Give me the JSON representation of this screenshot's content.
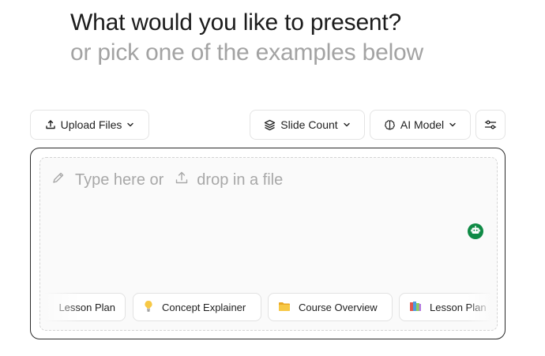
{
  "heading": {
    "title": "What would you like to present?",
    "subtitle": "or pick one of the examples below"
  },
  "toolbar": {
    "upload_label": "Upload Files",
    "slide_count_label": "Slide Count",
    "ai_model_label": "AI Model"
  },
  "input": {
    "prompt_left": "Type here or",
    "prompt_right": "drop in a file"
  },
  "examples": [
    {
      "label": "Lesson Plan",
      "icon": "notebook-icon"
    },
    {
      "label": "Concept Explainer",
      "icon": "lightbulb-icon"
    },
    {
      "label": "Course Overview",
      "icon": "folder-icon"
    },
    {
      "label": "Lesson Plan",
      "icon": "books-icon"
    }
  ],
  "colors": {
    "accent_green": "#0f8a45",
    "muted_text": "#a3a3a3",
    "border": "#e4e4e4"
  }
}
